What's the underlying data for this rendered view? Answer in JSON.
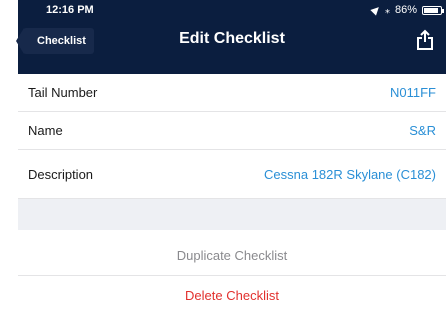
{
  "status_bar": {
    "time": "12:16 PM",
    "battery_text": "86%",
    "battery_level": 0.86
  },
  "nav": {
    "back_label": "Checklist",
    "title": "Edit Checklist",
    "share_icon": "share-icon"
  },
  "fields": [
    {
      "label": "Tail Number",
      "value": "N011FF"
    },
    {
      "label": "Name",
      "value": "S&R"
    },
    {
      "label": "Description",
      "value": "Cessna 182R Skylane (C182)"
    }
  ],
  "actions": {
    "duplicate_label": "Duplicate Checklist",
    "delete_label": "Delete Checklist"
  },
  "colors": {
    "header_bg": "#0b1e3f",
    "value_text": "#2a8fd6",
    "destructive": "#e2312e",
    "secondary_text": "#8a8a8e"
  }
}
